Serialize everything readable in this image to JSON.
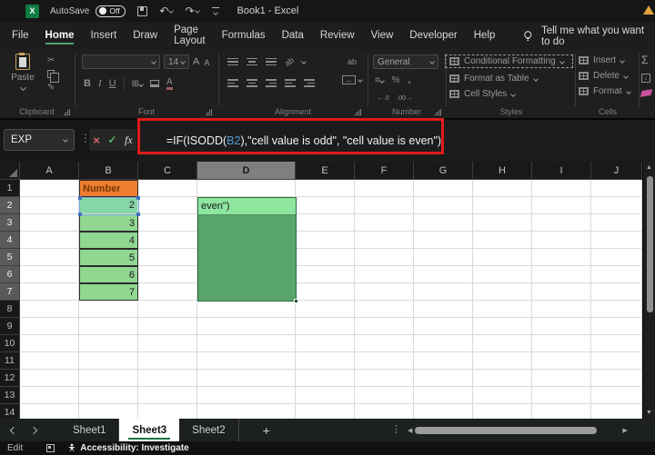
{
  "titlebar": {
    "app_icon": "X",
    "autosave_label": "AutoSave",
    "autosave_state": "Off",
    "title": "Book1 - Excel"
  },
  "menubar": {
    "tabs": [
      "File",
      "Home",
      "Insert",
      "Draw",
      "Page Layout",
      "Formulas",
      "Data",
      "Review",
      "View",
      "Developer",
      "Help"
    ],
    "active_tab": "Home",
    "tellme_label": "Tell me what you want to do"
  },
  "ribbon": {
    "clipboard": {
      "label": "Clipboard",
      "paste": "Paste"
    },
    "font": {
      "label": "Font",
      "size": "14",
      "bold": "B",
      "italic": "I",
      "underline": "U",
      "grow": "A",
      "shrink": "A"
    },
    "alignment": {
      "label": "Alignment",
      "orientation": "ab",
      "wrap": "ab",
      "merge_arrow": "↔"
    },
    "number": {
      "label": "Number",
      "format": "General",
      "currency": "¤",
      "percent": "%",
      "comma": ",",
      "inc_decimal": "←.0",
      "dec_decimal": ".00→"
    },
    "styles": {
      "label": "Styles",
      "conditional_formatting": "Conditional Formatting",
      "format_as_table": "Format as Table",
      "cell_styles": "Cell Styles"
    },
    "cells": {
      "label": "Cells",
      "insert": "Insert",
      "delete": "Delete",
      "format": "Format"
    },
    "editing": {
      "autosum": "Σ",
      "fill": "↓"
    }
  },
  "formula_bar": {
    "name_box": "EXP",
    "cancel": "×",
    "enter": "✓",
    "insert_function": "fx",
    "formula_prefix": "=IF(ISODD(",
    "formula_ref": "B2",
    "formula_suffix": "),\"cell value is odd\", \"cell value is even\")"
  },
  "grid": {
    "columns": [
      "A",
      "B",
      "C",
      "D",
      "E",
      "F",
      "G",
      "H",
      "I",
      "J"
    ],
    "selected_column": "D",
    "highlighted_rows": [
      2,
      3,
      4,
      5,
      6,
      7
    ],
    "row_count": 14,
    "cells": {
      "B1": "Number",
      "B2": "2",
      "B3": "3",
      "B4": "4",
      "B5": "5",
      "B6": "6",
      "B7": "7",
      "D2": "even\")"
    }
  },
  "sheet_bar": {
    "tabs": [
      "Sheet1",
      "Sheet3",
      "Sheet2"
    ],
    "active_tab": "Sheet3",
    "add_label": "+"
  },
  "status_bar": {
    "mode": "Edit",
    "accessibility": "Accessibility: Investigate"
  },
  "colors": {
    "excel_green": "#107C41",
    "tab_underline": "#4DA66F",
    "number_header_fill": "#ED7D31",
    "number_header_text": "#7C3A00",
    "value_cell_fill": "#90D792",
    "ref_cell_fill": "#87D7A6",
    "ref_border_blue": "#4472C4",
    "d2_fill": "#8DE59E",
    "d_range_fill": "#59A469",
    "annotation_red": "#DE1B1B",
    "formula_ref_blue": "#5B9BD5"
  }
}
